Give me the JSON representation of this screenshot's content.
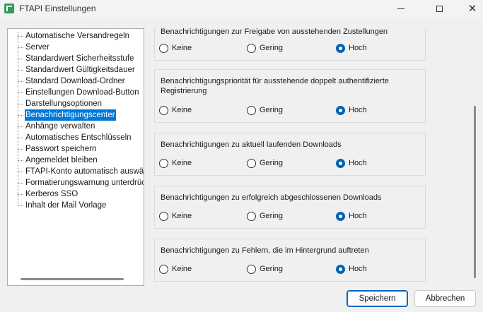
{
  "window": {
    "title": "FTAPI Einstellungen"
  },
  "sidebar": {
    "items": [
      {
        "label": "Automatische Versandregeln",
        "selected": false
      },
      {
        "label": "Server",
        "selected": false
      },
      {
        "label": "Standardwert Sicherheitsstufe",
        "selected": false
      },
      {
        "label": "Standardwert Gültigkeitsdauer",
        "selected": false
      },
      {
        "label": "Standard Download-Ordner",
        "selected": false
      },
      {
        "label": "Einstellungen Download-Button",
        "selected": false
      },
      {
        "label": "Darstellungsoptionen",
        "selected": false
      },
      {
        "label": "Benachrichtigungscenter",
        "selected": true
      },
      {
        "label": "Anhänge verwalten",
        "selected": false
      },
      {
        "label": "Automatisches Entschlüsseln",
        "selected": false
      },
      {
        "label": "Passwort speichern",
        "selected": false
      },
      {
        "label": "Angemeldet bleiben",
        "selected": false
      },
      {
        "label": "FTAPI-Konto automatisch auswählen",
        "selected": false
      },
      {
        "label": "Formatierungswarnung unterdrücken",
        "selected": false
      },
      {
        "label": "Kerberos SSO",
        "selected": false
      },
      {
        "label": "Inhalt der Mail Vorlage",
        "selected": false
      }
    ]
  },
  "options": {
    "none": "Keine",
    "low": "Gering",
    "high": "Hoch"
  },
  "groups": [
    {
      "title": "Benachrichtigungen zur Freigabe von ausstehenden Zustellungen",
      "selected": "high"
    },
    {
      "title": "Benachrichtigungspriorität für ausstehende doppelt authentifizierte Registrierung",
      "selected": "high"
    },
    {
      "title": "Benachrichtigungen zu aktuell laufenden Downloads",
      "selected": "high"
    },
    {
      "title": "Benachrichtigungen zu erfolgreich abgeschlossenen Downloads",
      "selected": "high"
    },
    {
      "title": "Benachrichtigungen zu Fehlern, die im Hintergrund auftreten",
      "selected": "high"
    }
  ],
  "buttons": {
    "save": "Speichern",
    "cancel": "Abbrechen"
  },
  "colors": {
    "accent": "#0078d7",
    "radio_checked": "#0063b1"
  }
}
